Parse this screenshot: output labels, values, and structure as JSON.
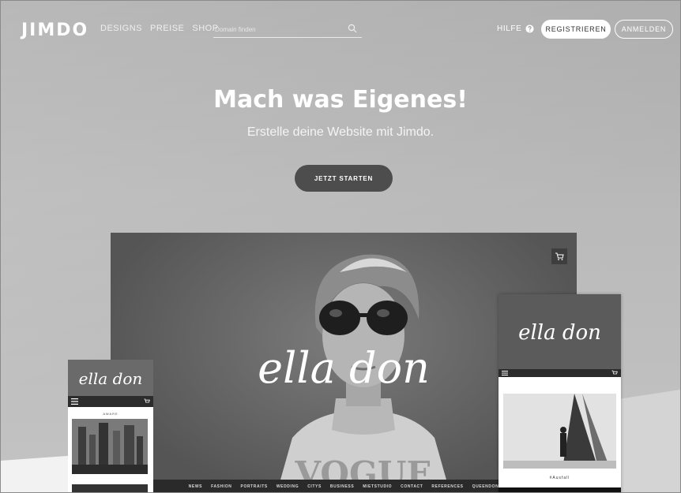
{
  "header": {
    "logo": "JIMDO",
    "nav": [
      "DESIGNS",
      "PREISE",
      "SHOP"
    ],
    "domain_search_placeholder": "Domain finden",
    "help_label": "HILFE",
    "register_label": "REGISTRIEREN",
    "login_label": "ANMELDEN"
  },
  "hero": {
    "title": "Mach was Eigenes!",
    "subtitle": "Erstelle deine Website mit Jimdo.",
    "cta": "JETZT STARTEN"
  },
  "showcase": {
    "brand": "ella don",
    "desktop_nav": [
      "NEWS",
      "FASHION",
      "PORTRAITS",
      "WEDDING",
      "CITYS",
      "BUSINESS",
      "MIETSTUDIO",
      "CONTACT",
      "REFERENCES",
      "QUEENDON"
    ],
    "shirt_text": "VOGUE",
    "phone_left_label": "AWARE",
    "phone_right_caption": "#Ausfall"
  },
  "colors": {
    "background": "#b4b4b4",
    "cta_background": "#4d4d4d",
    "register_background": "#ffffff"
  },
  "icons": [
    "search-icon",
    "help-icon",
    "cart-icon",
    "menu-icon"
  ]
}
